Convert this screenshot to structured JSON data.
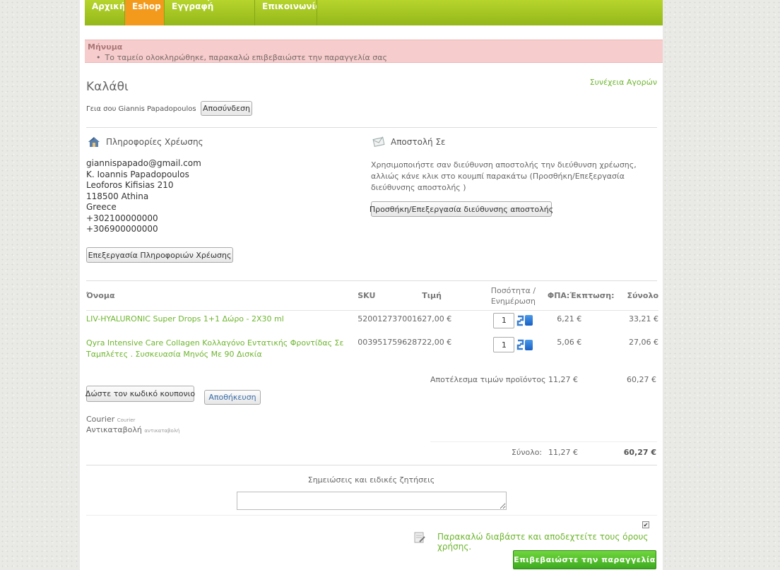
{
  "nav": {
    "items": [
      {
        "label": "Αρχική"
      },
      {
        "label": "Eshop"
      },
      {
        "label": "Είσοδος/Εγγραφή"
      },
      {
        "label": "Επικοινωνία"
      }
    ]
  },
  "message": {
    "title": "Μήνυμα",
    "text": "Το ταμείο ολοκληρώθηκε, παρακαλώ επιβεβαιώστε την παραγγελία σας"
  },
  "cart": {
    "title": "Καλάθι",
    "continue_link": "Συνέχεια Αγορών",
    "greeting": "Γεια σου Giannis Papadopoulos",
    "logout_label": "Αποσύνδεση"
  },
  "billing": {
    "heading": "Πληροφορίες Χρέωσης",
    "lines": [
      "giannispapado@gmail.com",
      "K. Ioannis Papadopoulos",
      "Leoforos Kifisias 210",
      "118500 Athina",
      "Greece",
      "+302100000000",
      "+306900000000"
    ],
    "edit_label": "Επεξεργασία Πληροφοριών Χρέωσης"
  },
  "shipping": {
    "heading": "Αποστολή Σε",
    "text": "Χρησιμοποιήστε σαν διεύθυνση αποστολής την διεύθυνση χρέωσης, αλλιώς κάνε κλικ στο κουμπί παρακάτω (Προσθήκη/Επεξεργασία διεύθυνσης αποστολής )",
    "button_label": "Προσθήκη/Επεξεργασία διεύθυνσης αποστολής"
  },
  "table": {
    "headers": {
      "name": "Όνομα",
      "sku": "SKU",
      "price": "Τιμή",
      "qty": "Ποσότητα / Ενημέρωση",
      "vat": "ΦΠΑ:Έκπτωση:",
      "total": "Σύνολο"
    },
    "rows": [
      {
        "name": "LIV-HYALURONIC Super Drops 1+1 Δώρο - 2X30 ml",
        "sku": "5200127370016",
        "price": "27,00 €",
        "qty": "1",
        "vat": "6,21 €",
        "total": "33,21 €"
      },
      {
        "name": "Qyra Intensive Care Collagen Κολλαγόνο Εντατικής Φροντίδας Σε Ταμπλέτες . Συσκευασία Μηνός Με 90 Δισκία",
        "sku": "0039517596287",
        "price": "22,00 €",
        "qty": "1",
        "vat": "5,06 €",
        "total": "27,06 €"
      }
    ],
    "subtotal_label": "Αποτέλεσμα τιμών προϊόντος",
    "subtotal_vat": "11,27 €",
    "subtotal_total": "60,27 €",
    "total_label": "Σύνολο:",
    "total_vat": "11,27 €",
    "total_total": "60,27 €"
  },
  "coupon": {
    "button_label": "Δώστε τον κωδικό κουπονιο",
    "save_label": "Αποθήκευση"
  },
  "shipment": {
    "method": "Courier",
    "method_sub": "Courier",
    "payment": "Αντικαταβολή",
    "payment_sub": "αντικαταβολή"
  },
  "notes": {
    "label": "Σημειώσεις και ειδικές ζητήσεις"
  },
  "terms": {
    "label": "Παρακαλώ διαβάστε και αποδεχτείτε τους όρους χρήσης."
  },
  "confirm_label": "Επιβεβαιώστε την παραγγελία",
  "colors": {
    "accent_green": "#6db52d",
    "nav_green": "#a4c625",
    "active_tab": "#f39a1c",
    "message_bg": "#f6cccc"
  }
}
